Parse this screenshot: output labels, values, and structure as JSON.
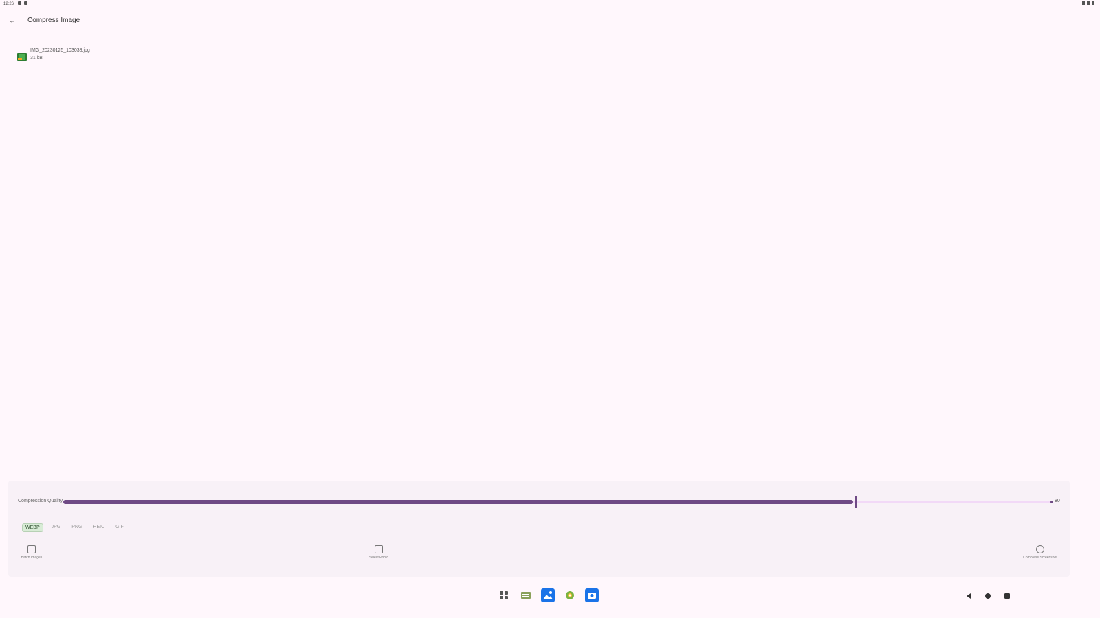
{
  "status_bar": {
    "time": "12:26"
  },
  "toolbar": {
    "title": "Compress Image",
    "back_icon": "back-arrow-icon"
  },
  "file": {
    "name": "IMG_20230125_103038.jpg",
    "size": "31 kB"
  },
  "quality": {
    "label": "Compression Quality",
    "value": 80,
    "value_text": "80",
    "min": 0,
    "max": 100
  },
  "formats": [
    "WEBP",
    "JPG",
    "PNG",
    "HEIC",
    "GIF"
  ],
  "actions": [
    {
      "label": "Batch Images",
      "icon": "images-icon"
    },
    {
      "label": "Select Photo",
      "icon": "photo-icon"
    },
    {
      "label": "Compress Screenshot",
      "icon": "refresh-icon"
    }
  ],
  "taskbar": {
    "apps": [
      "app-grid-icon",
      "files-icon",
      "gallery-icon",
      "chrome-icon",
      "camera-icon"
    ],
    "nav": [
      "back-icon",
      "home-icon",
      "recents-icon"
    ]
  },
  "colors": {
    "background": "#fff7fc",
    "accent": "#6f4a85",
    "track": "#f2d9f7",
    "chip_active": "#d8ecd6"
  }
}
